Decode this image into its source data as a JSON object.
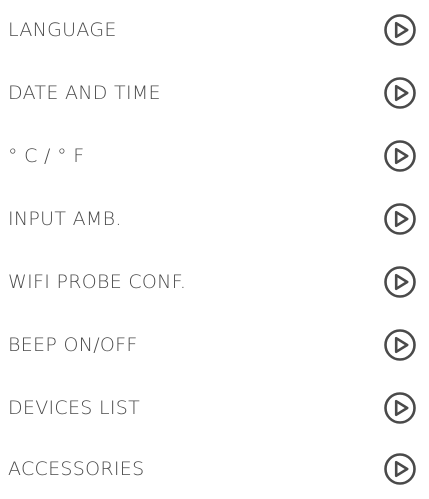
{
  "colors": {
    "text": "#4a4a4a",
    "icon": "#4a4a4a",
    "background": "#ffffff"
  },
  "menu": {
    "items": [
      {
        "label": "LANGUAGE",
        "icon": "play-circle-icon"
      },
      {
        "label": "DATE AND TIME",
        "icon": "play-circle-icon"
      },
      {
        "label": "° C / ° F",
        "icon": "play-circle-icon"
      },
      {
        "label": "INPUT AMB.",
        "icon": "play-circle-icon"
      },
      {
        "label": "WIFI PROBE CONF.",
        "icon": "play-circle-icon"
      },
      {
        "label": "BEEP ON/OFF",
        "icon": "play-circle-icon"
      },
      {
        "label": "DEVICES LIST",
        "icon": "play-circle-icon"
      },
      {
        "label": "ACCESSORIES",
        "icon": "play-circle-icon"
      }
    ]
  }
}
